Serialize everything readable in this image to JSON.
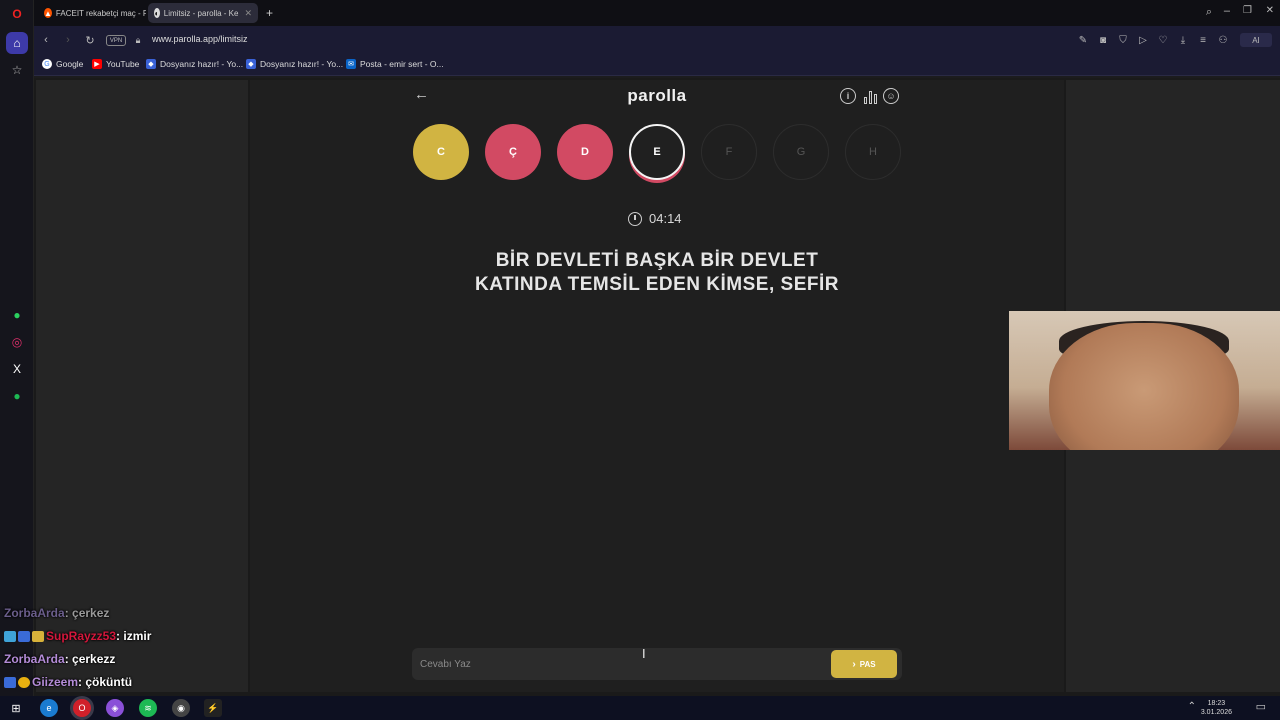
{
  "browser": {
    "tabs": [
      {
        "title": "FACEIT rekabetçi maç - FA"
      },
      {
        "title": "Limitsiz - parolla - Ke"
      }
    ],
    "new_tab": "+",
    "url": "www.parolla.app/limitsiz",
    "vpn": "VPN",
    "ai_label": "AI",
    "bookmarks": [
      {
        "label": "Google"
      },
      {
        "label": "YouTube"
      },
      {
        "label": "Dosyanız hazır! - Yo..."
      },
      {
        "label": "Dosyanız hazır! - Yo..."
      },
      {
        "label": "Posta - emir sert - O..."
      }
    ]
  },
  "app": {
    "title": "parolla",
    "letters": [
      {
        "letter": "C",
        "state": "correct"
      },
      {
        "letter": "Ç",
        "state": "wrong"
      },
      {
        "letter": "D",
        "state": "wrong"
      },
      {
        "letter": "E",
        "state": "active"
      },
      {
        "letter": "F",
        "state": "pending"
      },
      {
        "letter": "G",
        "state": "pending"
      },
      {
        "letter": "H",
        "state": "pending"
      }
    ],
    "timer": "04:14",
    "question_line1": "BİR DEVLETİ BAŞKA BİR DEVLET",
    "question_line2": "KATINDA TEMSİL EDEN KİMSE, SEFİR",
    "answer_placeholder": "Cevabı Yaz",
    "pass_label": "PAS",
    "colors": {
      "correct": "#d1b442",
      "wrong": "#d24a63"
    }
  },
  "chat": [
    {
      "user": "ZorbaArda",
      "message": ": çerkez",
      "user_color": "#6b5e8c"
    },
    {
      "user": "SupRayzz53",
      "message": ": izmir",
      "user_color": "#d4173c"
    },
    {
      "user": "ZorbaArda",
      "message": ": çerkezz",
      "user_color": "#b48cd8"
    },
    {
      "user": "Giizeem",
      "message": ": çöküntü",
      "user_color": "#b48cd8"
    }
  ],
  "taskbar": {
    "time": "18:23",
    "date": "3.01.2026"
  }
}
